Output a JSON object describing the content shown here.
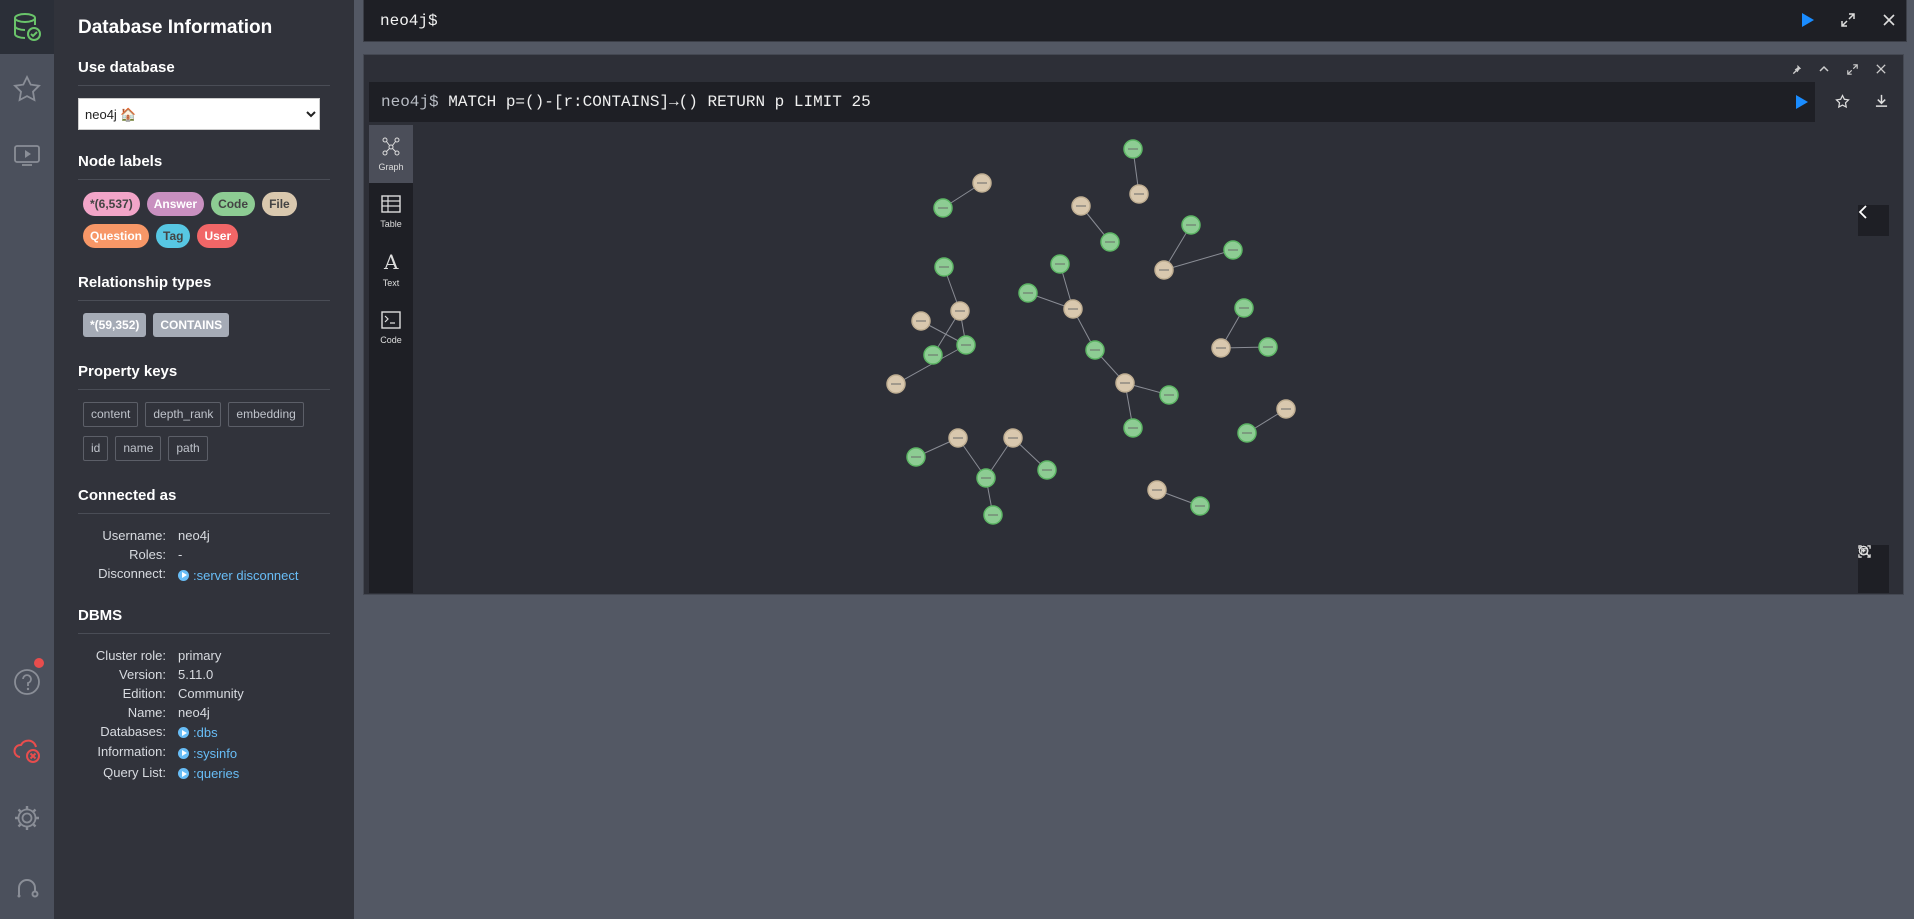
{
  "drawer": {
    "title": "Database Information",
    "use_database": {
      "heading": "Use database",
      "selected": "neo4j 🏠"
    },
    "node_labels": {
      "heading": "Node labels",
      "items": [
        {
          "label": "*(6,537)",
          "color": "#f2a5c8",
          "text_color": "#444"
        },
        {
          "label": "Answer",
          "color": "#c990c0",
          "text_color": "#fff"
        },
        {
          "label": "Code",
          "color": "#8dcc93",
          "text_color": "#444"
        },
        {
          "label": "File",
          "color": "#d9c8ae",
          "text_color": "#444"
        },
        {
          "label": "Question",
          "color": "#f79767",
          "text_color": "#fff"
        },
        {
          "label": "Tag",
          "color": "#57c7e3",
          "text_color": "#444"
        },
        {
          "label": "User",
          "color": "#f16667",
          "text_color": "#fff"
        }
      ]
    },
    "relationship_types": {
      "heading": "Relationship types",
      "items": [
        {
          "label": "*(59,352)"
        },
        {
          "label": "CONTAINS"
        }
      ]
    },
    "property_keys": {
      "heading": "Property keys",
      "items": [
        "content",
        "depth_rank",
        "embedding",
        "id",
        "name",
        "path"
      ]
    },
    "connected_as": {
      "heading": "Connected as",
      "rows": [
        {
          "key": "Username:",
          "value": "neo4j"
        },
        {
          "key": "Roles:",
          "value": "-"
        },
        {
          "key": "Disconnect:",
          "value": ":server disconnect",
          "link": true
        }
      ]
    },
    "dbms": {
      "heading": "DBMS",
      "rows": [
        {
          "key": "Cluster role:",
          "value": "primary"
        },
        {
          "key": "Version:",
          "value": "5.11.0"
        },
        {
          "key": "Edition:",
          "value": "Community"
        },
        {
          "key": "Name:",
          "value": "neo4j"
        },
        {
          "key": "Databases:",
          "value": ":dbs",
          "link": true
        },
        {
          "key": "Information:",
          "value": ":sysinfo",
          "link": true
        },
        {
          "key": "Query List:",
          "value": ":queries",
          "link": true
        }
      ]
    }
  },
  "editor": {
    "prompt": "neo4j$"
  },
  "frame": {
    "prompt": "neo4j$",
    "query": "MATCH p=()-[r:CONTAINS]→() RETURN p LIMIT 25",
    "view_tabs": [
      {
        "label": "Graph",
        "icon": "graph-icon",
        "active": true
      },
      {
        "label": "Table",
        "icon": "table-icon",
        "active": false
      },
      {
        "label": "Text",
        "icon": "text-icon",
        "active": false
      },
      {
        "label": "Code",
        "icon": "code-icon",
        "active": false
      }
    ]
  },
  "colors": {
    "code_node": "#8dcc93",
    "file_node": "#d9c8ae",
    "accent_link": "#68bdf6",
    "play": "#1a8cff"
  }
}
